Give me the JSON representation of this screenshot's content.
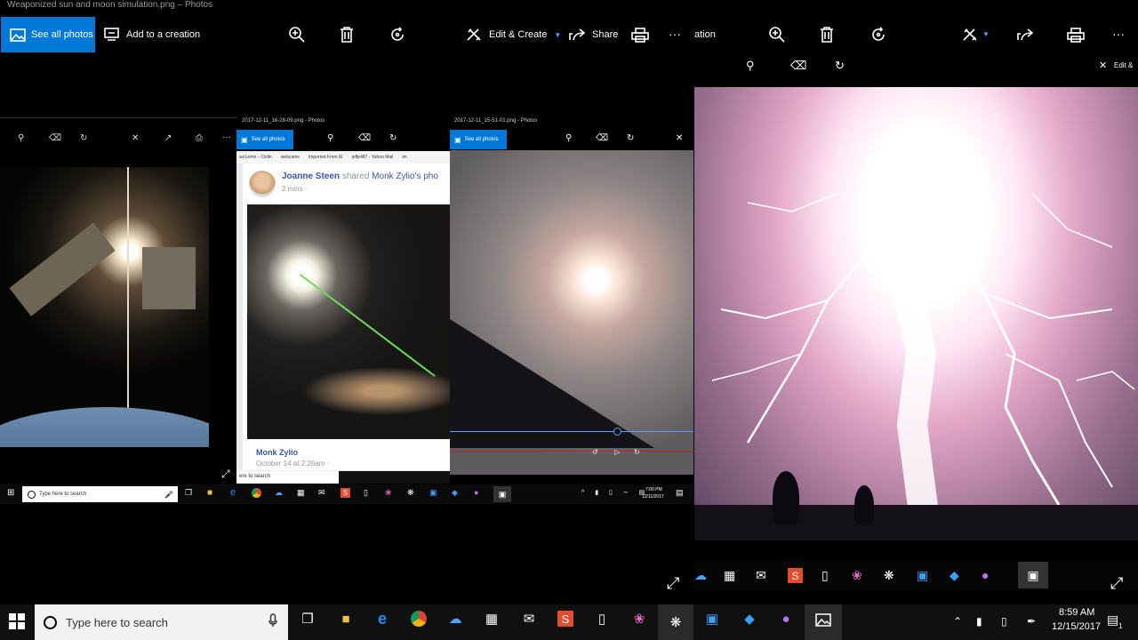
{
  "main_window": {
    "title": "Weaponized sun and moon simulation.png – Photos",
    "see_all_photos": "See all photos",
    "add_to_creation": "Add to a creation",
    "edit_create": "Edit & Create",
    "share": "Share",
    "more": "···"
  },
  "right_window": {
    "partial_label": "ation",
    "edit_partial": "Edit &",
    "more": "···"
  },
  "window_a": {
    "title": "2017-12-11_16-28-09.png - Photos",
    "see_all": "See all photos"
  },
  "window_b": {
    "title": "2017-12-11_15-51-01.png - Photos",
    "see_all": "See all photos"
  },
  "facebook": {
    "bookmarks": [
      "wx1zimn – Onlin",
      "webcams",
      "Imported From IE",
      "jeffp487 - Yahoo Mail",
      "im"
    ],
    "poster": "Joanne Steen",
    "shared": "shared",
    "page": "Monk Zylio",
    "photo_suffix": "'s pho",
    "time": "2 mins ·",
    "comment_author": "Monk Zylio",
    "comment_time": "October 14 at 2:26am ·"
  },
  "inner_taskbar": {
    "search_placeholder": "Type here to search",
    "search_placeholder_2": "ere to search",
    "time": "7:00 PM",
    "date": "12/11/2017"
  },
  "taskbar": {
    "search_placeholder": "Type here to search",
    "time": "8:59 AM",
    "date": "12/15/2017",
    "notification_count": "1"
  },
  "colors": {
    "accent": "#0078d7",
    "taskbar": "#101010"
  }
}
